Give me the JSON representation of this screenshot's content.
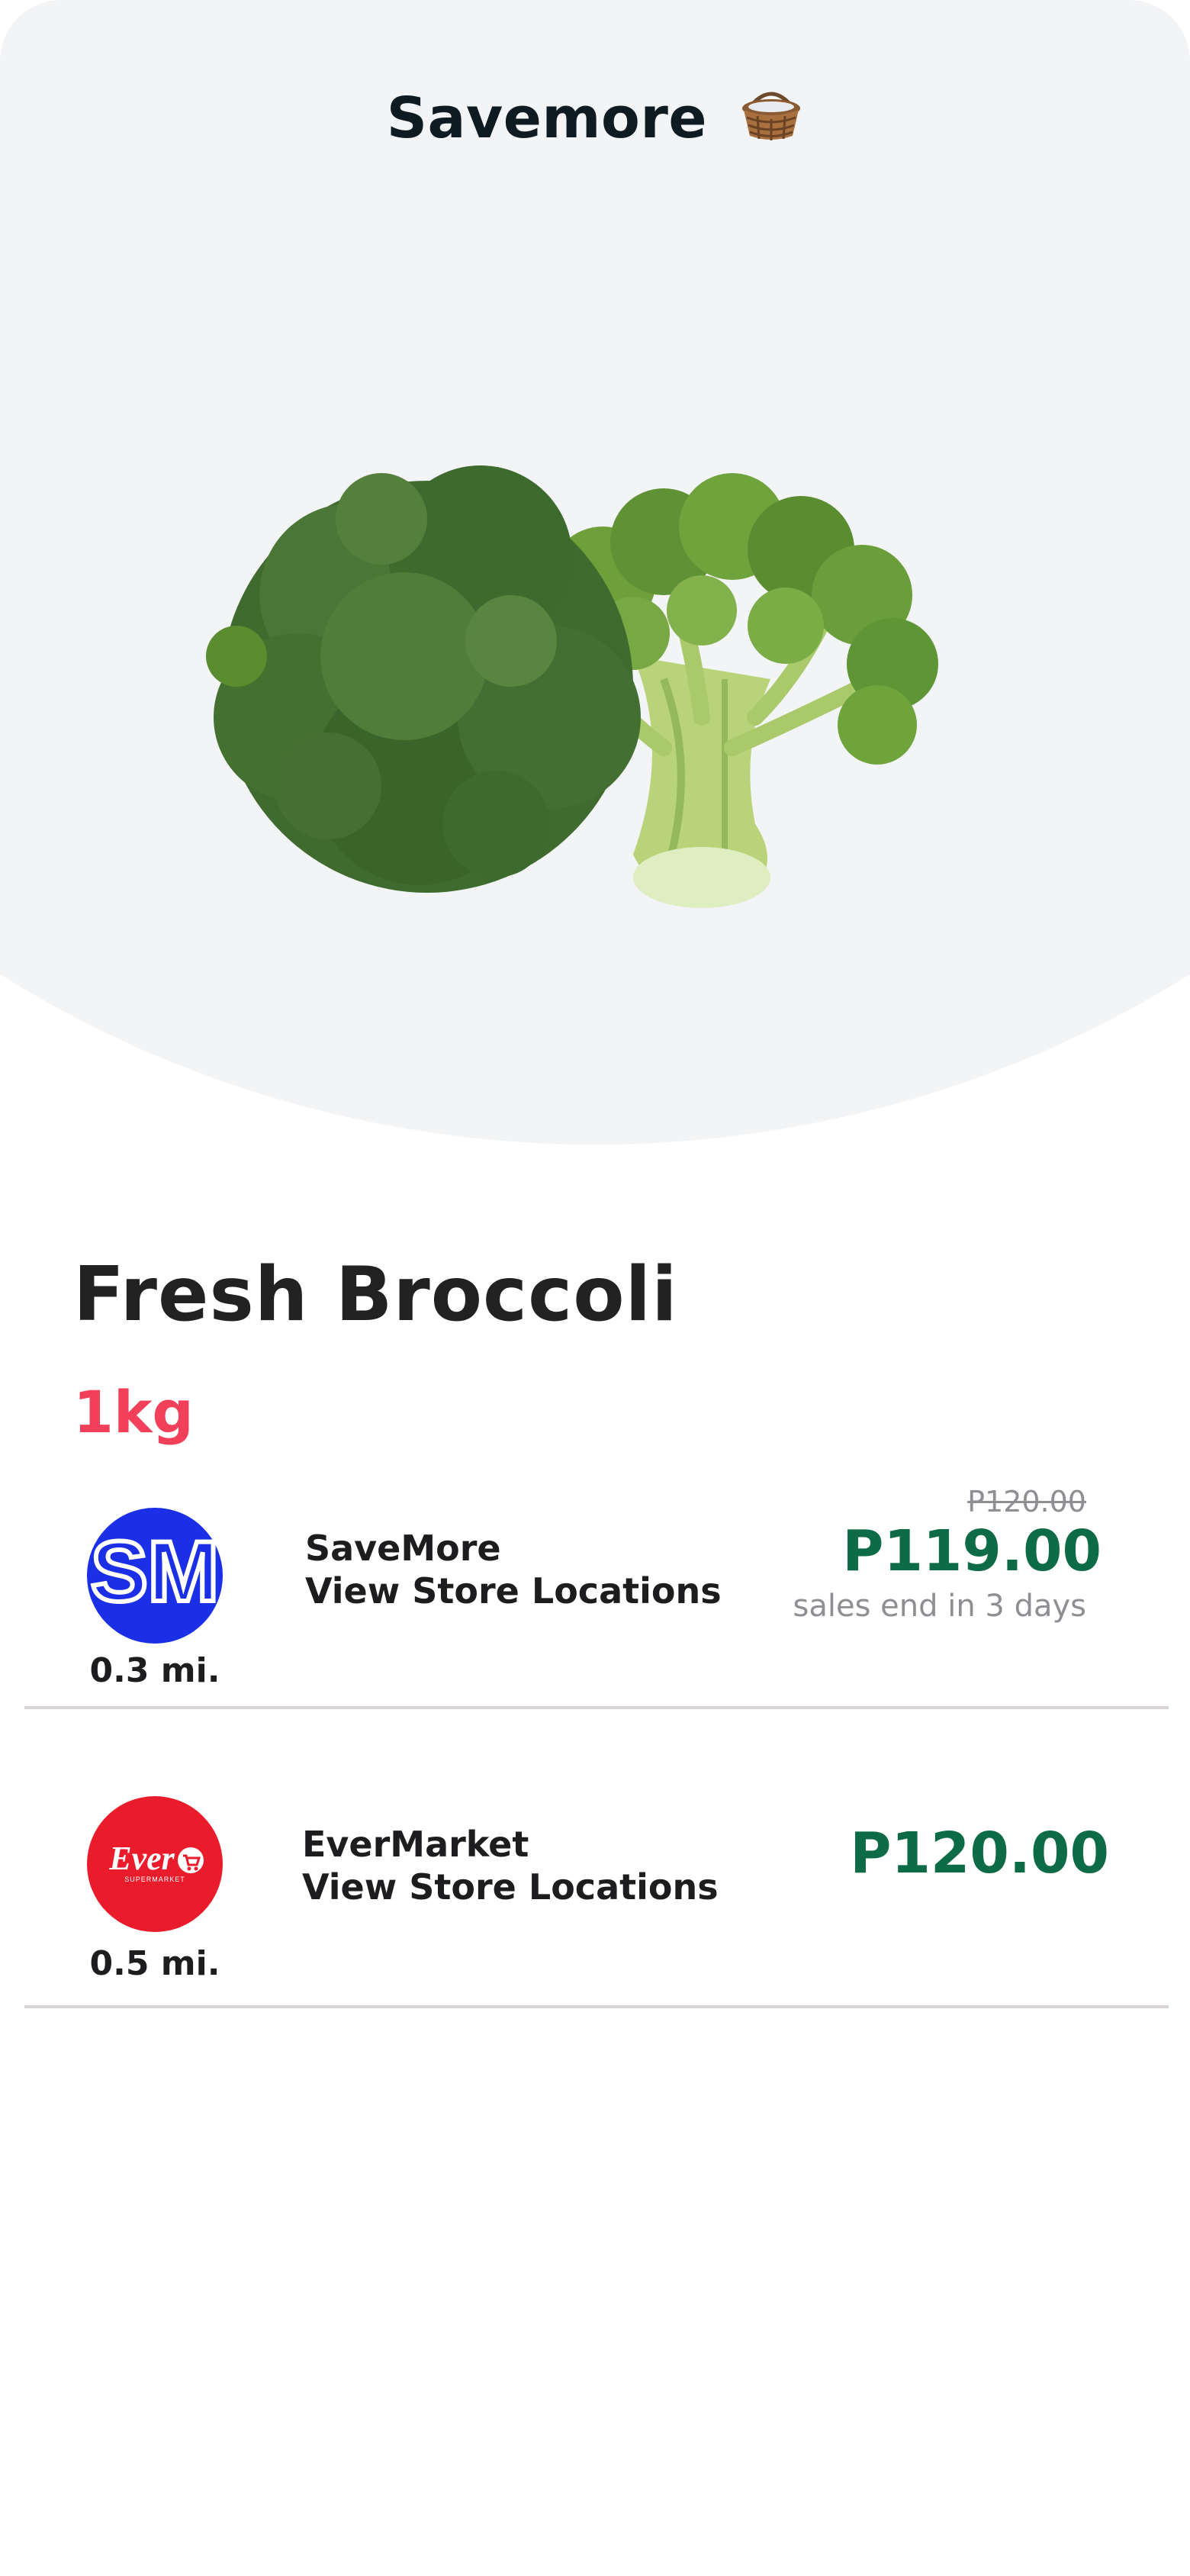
{
  "header": {
    "title": "Savemore",
    "title_icon": "basket-icon"
  },
  "product": {
    "name": "Fresh Broccoli",
    "quantity": "1kg",
    "image": "broccoli-image"
  },
  "stores": [
    {
      "name": "SaveMore",
      "link_label": "View Store Locations",
      "distance": "0.3 mi.",
      "old_price": "P120.00",
      "price": "P119.00",
      "sale_note": "sales end in 3 days",
      "logo_text": "SM",
      "logo_color": "#1a2fe6"
    },
    {
      "name": "EverMarket",
      "link_label": "View Store Locations",
      "distance": "0.5 mi.",
      "price": "P120.00",
      "logo_text": "Ever",
      "logo_subtext": "SUPERMARKET",
      "logo_color": "#ea1c2b"
    }
  ],
  "colors": {
    "accent_red": "#f23f5a",
    "price_green": "#0e6b47",
    "hero_bg": "#f3f4f6",
    "muted": "#8e8e93"
  }
}
